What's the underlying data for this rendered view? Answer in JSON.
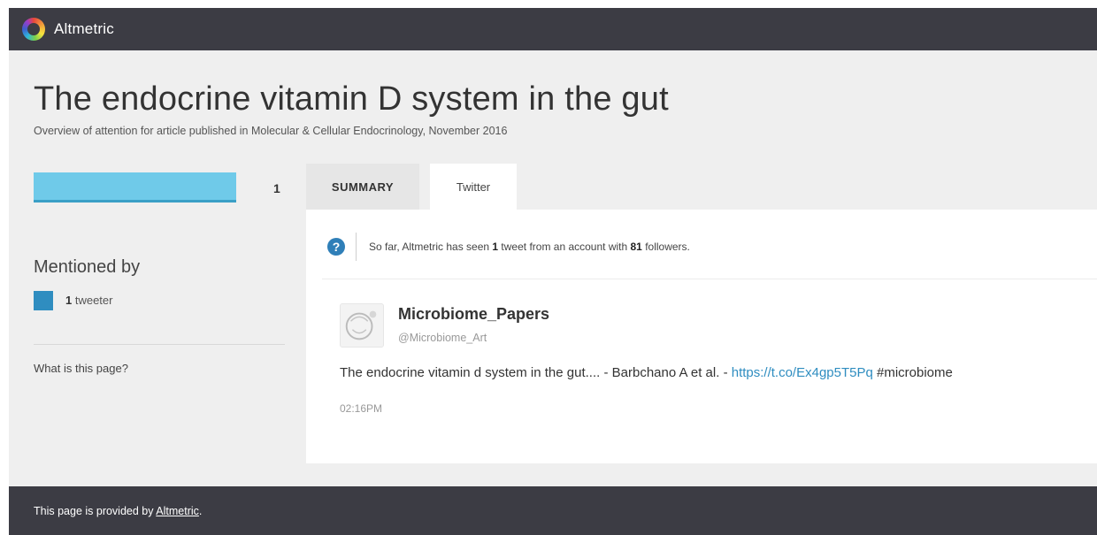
{
  "app": {
    "brand": "Altmetric"
  },
  "article": {
    "title": "The endocrine vitamin D system in the gut",
    "subtitle": "Overview of attention for article published in Molecular & Cellular Endocrinology, November 2016"
  },
  "score": {
    "value": "1",
    "bar_fill_fraction": 1.0,
    "bar_color": "#6fcae9"
  },
  "sidebar": {
    "mentioned_heading": "Mentioned by",
    "tweeter_count": "1",
    "tweeter_label": " tweeter",
    "tweeter_color": "#2f8dc0",
    "what_link": "What is this page?"
  },
  "tabs": [
    {
      "label": "SUMMARY",
      "active": false
    },
    {
      "label": "Twitter",
      "active": true
    }
  ],
  "twitter": {
    "info_icon": "question-circle-icon",
    "info_prefix": "So far, Altmetric has seen ",
    "tweet_count": "1",
    "info_middle": " tweet from an account with ",
    "follower_count": "81",
    "info_suffix": " followers.",
    "tweet": {
      "display_name": "Microbiome_Papers",
      "handle": "@Microbiome_Art",
      "text_before": "The endocrine vitamin d system in the gut.... - Barbchano A et al. - ",
      "link": "https://t.co/Ex4gp5T5Pq",
      "text_after": " #microbiome",
      "time": "02:16PM"
    }
  },
  "footer": {
    "prefix": "This page is provided by ",
    "link": "Altmetric",
    "suffix": "."
  },
  "colors": {
    "header_bg": "#3c3c44",
    "page_bg": "#efefef",
    "link": "#2f8dc0"
  }
}
